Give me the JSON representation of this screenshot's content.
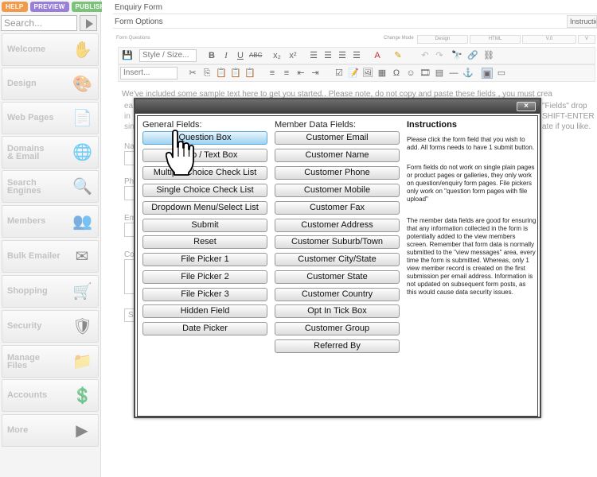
{
  "topbar": {
    "help": "HELP",
    "preview": "PREVIEW",
    "publish": "PUBLISH"
  },
  "search": {
    "placeholder": "Search..."
  },
  "sidebar": {
    "items": [
      {
        "label": "Welcome",
        "icon": "hand-icon"
      },
      {
        "label": "Design",
        "icon": "palette-icon"
      },
      {
        "label": "Web Pages",
        "icon": "pages-icon"
      },
      {
        "label": "Domains\n& Email",
        "icon": "globe-icon"
      },
      {
        "label": "Search\nEngines",
        "icon": "magnifier-icon"
      },
      {
        "label": "Members",
        "icon": "people-icon"
      },
      {
        "label": "Bulk Emailer",
        "icon": "envelope-icon"
      },
      {
        "label": "Shopping",
        "icon": "cart-icon"
      },
      {
        "label": "Security",
        "icon": "shield-icon"
      },
      {
        "label": "Manage\nFiles",
        "icon": "folder-icon"
      },
      {
        "label": "Accounts",
        "icon": "dollar-icon"
      },
      {
        "label": "More",
        "icon": "play-icon"
      }
    ]
  },
  "main": {
    "title": "Enquiry Form",
    "subtitle": "Form Options",
    "instructions_tab": "Instructio",
    "form_questions_label": "Form Questions",
    "change_mode_label": "Change Mode",
    "mode_tabs": [
      "Design",
      "HTML",
      "V.0",
      "V"
    ],
    "style_select": "Style / Size...",
    "insert_select": "Insert...",
    "bg_text_1": "We've included some sample text here to get you started.. Please note, do not copy and paste these fields  , you must crea",
    "bg_text_2": "ea",
    "bg_text_3": "in",
    "bg_text_4": "sin",
    "bg_right_1": "\"Fields\" drop",
    "bg_right_2": "SHIFT-ENTER",
    "bg_right_3": "ate if you like.",
    "bg_fields": [
      "Na",
      "Ph",
      "Em",
      "Co"
    ],
    "bg_submit": "S"
  },
  "modal": {
    "close": "×",
    "general_heading": "General Fields:",
    "member_heading": "Member Data Fields:",
    "instructions_heading": "Instructions",
    "general_fields": [
      "Question Box",
      "Memo / Text Box",
      "Multiple Choice Check List",
      "Single Choice Check List",
      "Dropdown Menu/Select List",
      "Submit",
      "Reset",
      "File Picker 1",
      "File Picker 2",
      "File Picker 3",
      "Hidden Field",
      "Date Picker"
    ],
    "member_fields": [
      "Customer Email",
      "Customer Name",
      "Customer Phone",
      "Customer Mobile",
      "Customer Fax",
      "Customer Address",
      "Customer Suburb/Town",
      "Customer City/State",
      "Customer State",
      "Customer Country",
      "Opt In Tick Box",
      "Customer Group",
      "Referred By"
    ],
    "instructions": [
      "Please click the form field that you wish to add. All forms needs to have 1 submit button.",
      "Form fields do not work on single plain pages or product pages or galleries, they only work on question/enquiry form pages. File pickers only work on \"question form pages with file upload\"",
      "The member data fields are good for ensuring that any information collected in the form is potentially added to the view members screen. Remember that form data is normally submitted to the \"view messages\" area, every time the form is submitted. Whereas, only 1 view member record is created on the first submission per email address. Information is not updated on subsequent form posts, as this would cause data security issues."
    ]
  }
}
